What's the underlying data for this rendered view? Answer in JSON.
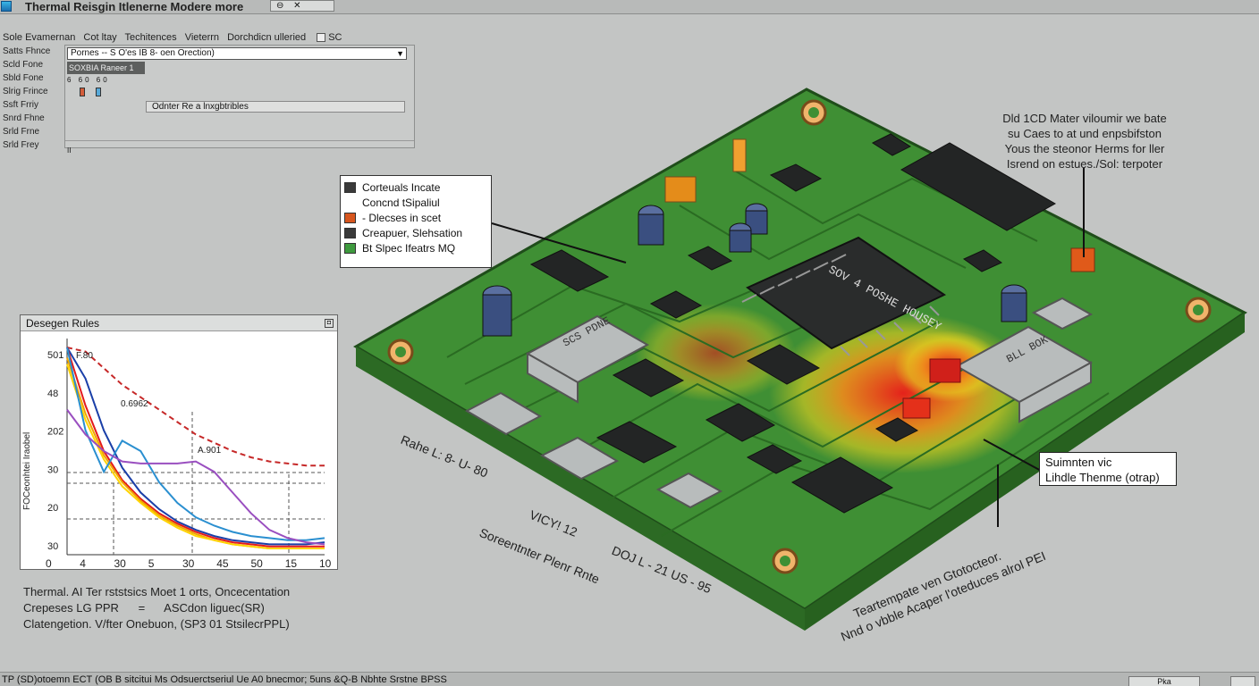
{
  "window": {
    "title": "Thermal Reisgin Itlenerne Modere more",
    "controls": "⊖ ✕"
  },
  "menubar": {
    "items": [
      "Sole Evamernan",
      "Cot ltay",
      "Techitences",
      "Vieterrn",
      "Dorchdicn ulleried"
    ],
    "tail": "SC"
  },
  "sidebar": {
    "items": [
      "Satts Fhnce",
      "Scld Fone",
      "Sbld Fone",
      "Slrig Frince",
      "Ssft Frriy",
      "Snrd Fhne",
      "Srld Frne",
      "Srld Frey"
    ]
  },
  "properties": {
    "combo_value": "Pornes -- S O'es IB 8- oen Orection)",
    "header": "SOXBIA Raneer 1",
    "numbers": "6 60 60",
    "note": "Odnter Re a lnxgbtribles",
    "footer_mark": "II"
  },
  "legend": {
    "items": [
      {
        "label": "Corteuals Incate",
        "color": "#3a3a3a"
      },
      {
        "label": "Concnd tSipaliul",
        "color": ""
      },
      {
        "label": "- Dlecses in scet",
        "color": "#d7561e"
      },
      {
        "label": "Creapuer, Slehsation",
        "color": "#3a3a3a"
      },
      {
        "label": "Bt Slpec Ifeatrs MQ",
        "color": "#3e9a3e"
      }
    ]
  },
  "annotation_top_right": [
    "Dld 1CD Mater viloumir we bate",
    "su Caes to at und enpsbifston",
    "Yous the steonor Herms for ller",
    "Isrend on estues./Sol: terpoter"
  ],
  "summary_box": [
    "Suimnten vic",
    "Lihdle Thenme (otrap)"
  ],
  "board_labels": {
    "left_1": "Rahe L: 8- U- 80",
    "left_2": "VICY! 12",
    "left_3": "Soreentnter Plenr Rnte",
    "bottom_1": "DOJ  L - 21  US - 95",
    "bottom_2": "Teartempate ven Gtotocteor.",
    "bottom_3": "Nnd o vbble Acaper l'oteduces alrol PEI",
    "chips": [
      "SCS PDNE",
      "SOV 4 POSHE HOUSEY",
      "BLL BOK"
    ]
  },
  "chart_window": {
    "title": "Desegen Rules",
    "close_icon": "◘"
  },
  "chart_data": {
    "type": "line",
    "title": "",
    "ylabel": "FOCeonhtei Iraobel",
    "xtick_labels": [
      "0",
      "4",
      "30",
      "5",
      "30",
      "45",
      "50",
      "15",
      "10"
    ],
    "ytick_labels": [
      "501",
      "48",
      "202",
      "30",
      "20",
      "30"
    ],
    "annotations": [
      "F.80",
      "0.6962",
      "A.901"
    ],
    "series": [
      {
        "color": "#c62828",
        "style": "dashed",
        "y": [
          100,
          98,
          90,
          82,
          76,
          70,
          64,
          58,
          54,
          50,
          47,
          45,
          44,
          43,
          43
        ]
      },
      {
        "color": "#1a3fa8",
        "style": "solid",
        "y": [
          100,
          85,
          60,
          42,
          30,
          22,
          16,
          12,
          9,
          7,
          6,
          5,
          5,
          5,
          6
        ]
      },
      {
        "color": "#e31a1c",
        "style": "solid",
        "y": [
          100,
          72,
          50,
          36,
          27,
          20,
          15,
          11,
          8,
          6,
          5,
          4,
          4,
          4,
          4
        ]
      },
      {
        "color": "#f0a500",
        "style": "solid",
        "y": [
          95,
          68,
          48,
          35,
          26,
          19,
          14,
          10,
          7,
          5,
          4,
          3,
          3,
          3,
          3
        ]
      },
      {
        "color": "#ffd400",
        "style": "solid",
        "y": [
          92,
          65,
          46,
          33,
          25,
          18,
          13,
          9,
          7,
          5,
          4,
          3,
          3,
          3,
          3
        ]
      },
      {
        "color": "#2a8fd0",
        "style": "solid",
        "y": [
          100,
          60,
          40,
          55,
          50,
          35,
          25,
          18,
          14,
          11,
          9,
          8,
          7,
          7,
          8
        ]
      },
      {
        "color": "#9a4fc0",
        "style": "solid",
        "y": [
          70,
          58,
          50,
          45,
          44,
          44,
          44,
          45,
          40,
          30,
          20,
          12,
          8,
          6,
          5
        ]
      }
    ]
  },
  "caption": [
    "Thermal. AI Ter rststsics Moet 1 orts, Oncecentation",
    "Crepeses LG PPR      =      ASCdon liguec(SR)",
    "Clatengetion. V/fter Onebuon, (SP3 01 StsilecrPPL)"
  ],
  "statusbar": {
    "text": "TP (SD)otoemn  ECT (OB B sitcitui  Ms Odsuerctseriul  Ue A0 bnecmor;  5uns &Q-B  Nbhte  Srstne BPSS",
    "btn1": "Pka",
    "btn2": ""
  }
}
